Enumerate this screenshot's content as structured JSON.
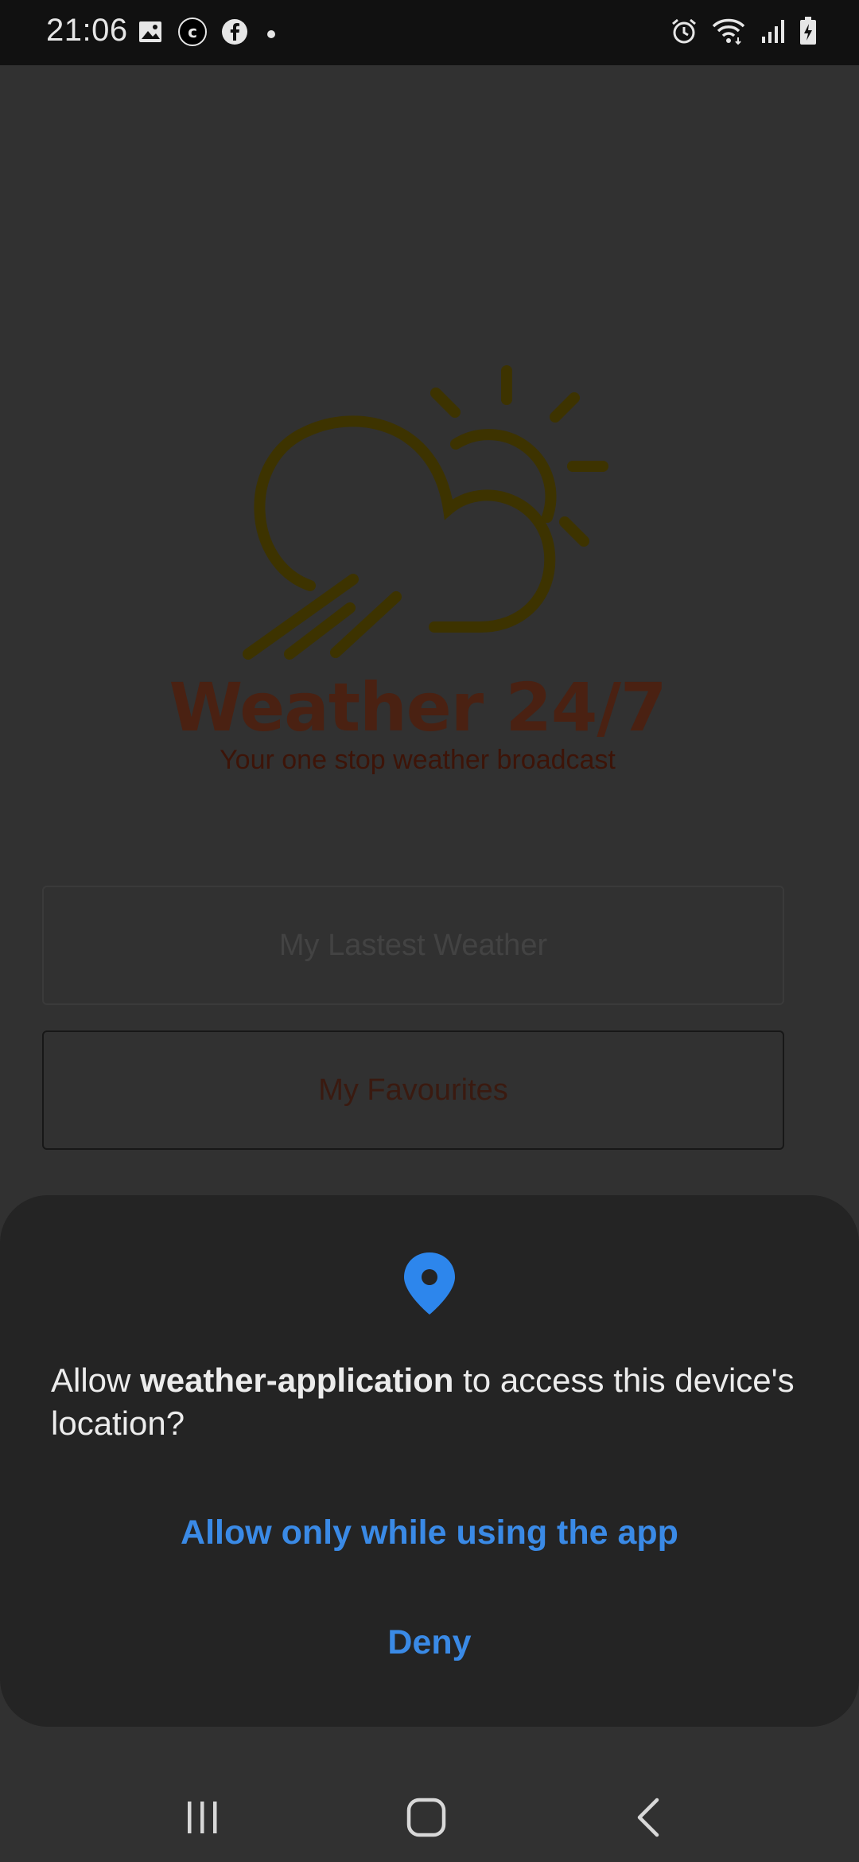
{
  "status_bar": {
    "time": "21:06",
    "left_icons": [
      "gallery-icon",
      "app-c-icon",
      "facebook-icon",
      "dot-icon"
    ],
    "right_icons": [
      "alarm-icon",
      "wifi-icon",
      "signal-icon",
      "battery-charging-icon"
    ]
  },
  "app": {
    "title": "Weather 24/7",
    "tagline": "Your one stop weather broadcast",
    "buttons": {
      "latest": "My Lastest Weather",
      "favourites": "My Favourites"
    },
    "colors": {
      "background_dimmed": "#313131",
      "logo_sun_cloud": "#3d3300",
      "logo_text": "#4a2112"
    }
  },
  "permission_dialog": {
    "icon": "location-pin-icon",
    "message_prefix": "Allow ",
    "app_name": "weather-application",
    "message_suffix": " to access this device's location?",
    "allow_button": "Allow only while using the app",
    "deny_button": "Deny",
    "accent_color": "#3a8ae6"
  },
  "nav_bar": {
    "items": [
      "recent-apps-icon",
      "home-icon",
      "back-icon"
    ]
  }
}
